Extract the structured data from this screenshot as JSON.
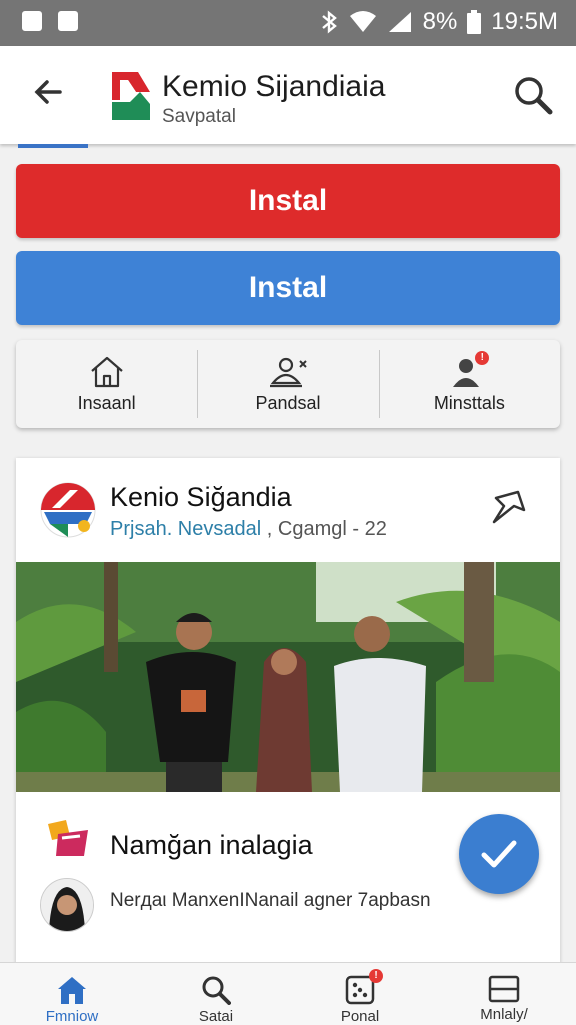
{
  "status_bar": {
    "battery": "8%",
    "time": "19:5M"
  },
  "header": {
    "title": "Kemio Sijandiaia",
    "subtitle": "Savpatal"
  },
  "buttons": {
    "primary_label": "Instal",
    "secondary_label": "Instal"
  },
  "quick_actions": [
    {
      "label": "Insaanl",
      "icon": "home-icon"
    },
    {
      "label": "Pandsal",
      "icon": "people-icon"
    },
    {
      "label": "Minsttals",
      "icon": "person-badge-icon"
    }
  ],
  "post": {
    "title": "Kenio Siğandia",
    "source": "Prjsah. Nevsadal",
    "separator": ",",
    "meta": "Cgamgl - 22",
    "promo_title": "Namğan inalagia",
    "comment": "Nerдaι ManхenΙNanail agner 7apbasn"
  },
  "bottom_nav": [
    {
      "label": "Fmniow",
      "icon": "home-icon",
      "active": true
    },
    {
      "label": "Satai",
      "icon": "search-icon",
      "active": false
    },
    {
      "label": "Ponal",
      "icon": "dice-icon",
      "active": false
    },
    {
      "label": "Mnlaly/",
      "icon": "window-icon",
      "active": false
    }
  ],
  "colors": {
    "accent_red": "#de2b2b",
    "accent_blue": "#3e82d6",
    "status_bar": "#757575"
  }
}
